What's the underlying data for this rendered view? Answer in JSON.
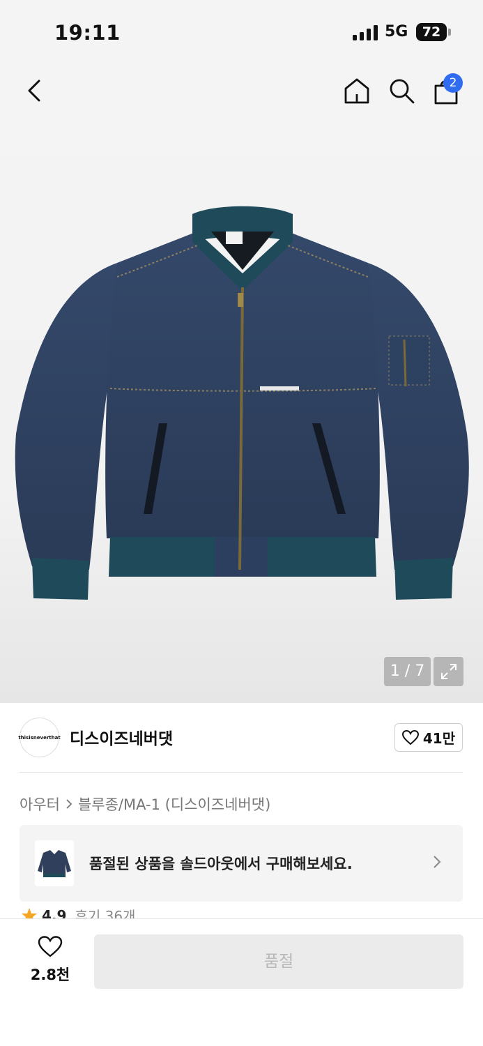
{
  "status_bar": {
    "time": "19:11",
    "network": "5G",
    "battery": "72"
  },
  "header": {
    "cart_count": "2",
    "icons": [
      "back-icon",
      "home-icon",
      "search-icon",
      "cart-icon"
    ]
  },
  "gallery": {
    "pager": "1 / 7"
  },
  "brand": {
    "logo_text": "thisisneverthat",
    "name": "디스이즈네버댓",
    "likes": "41만"
  },
  "breadcrumb": {
    "items": [
      "아우터",
      "블루종/MA-1 (디스이즈네버댓)"
    ]
  },
  "soldout_banner": {
    "text": "품절된 상품을 솔드아웃에서 구매해보세요."
  },
  "rating": {
    "score": "4.9",
    "reviews": "후기 36개"
  },
  "bottom_bar": {
    "wish_count": "2.8천",
    "buy_label": "품절"
  },
  "colors": {
    "accent": "#2f6cf0",
    "star": "#f5a623",
    "denim": "#2f3f5c",
    "rib": "#1f4a5a"
  }
}
